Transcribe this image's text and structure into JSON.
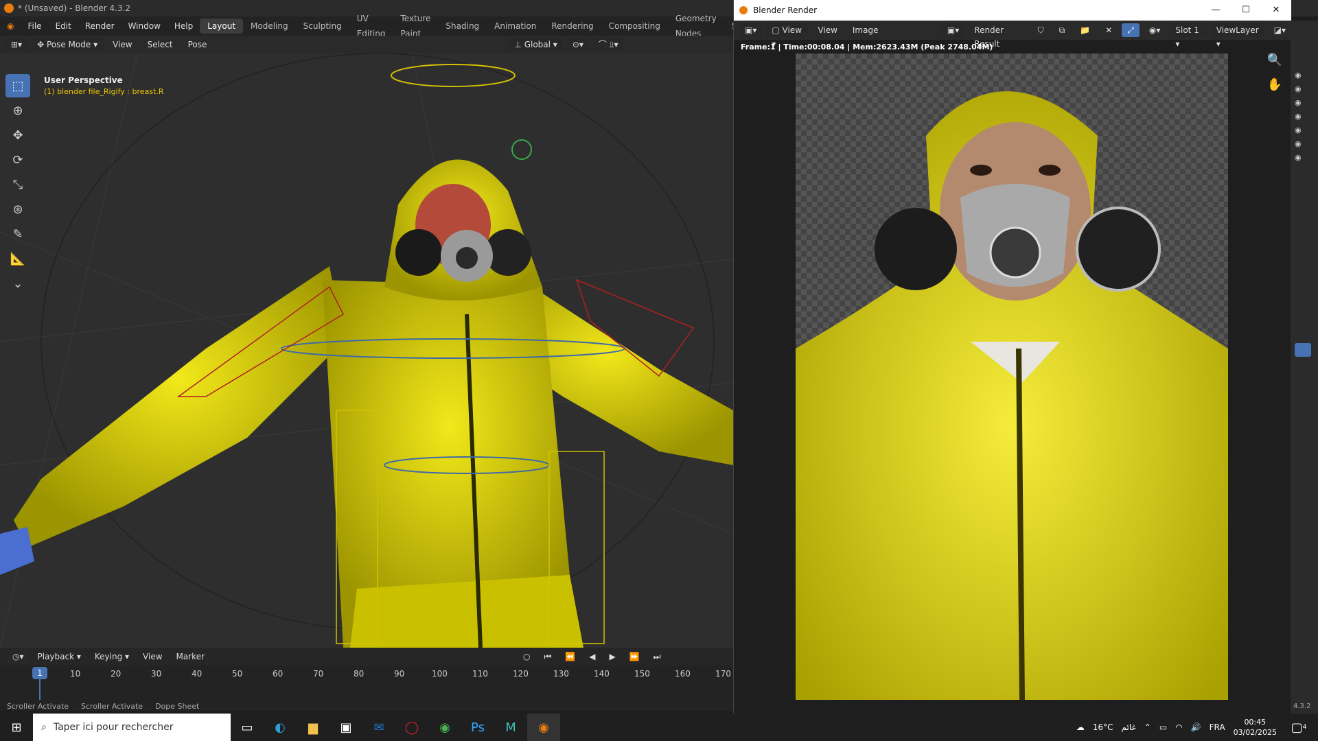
{
  "titlebar": {
    "title": "* (Unsaved) - Blender 4.3.2"
  },
  "menu": [
    "File",
    "Edit",
    "Render",
    "Window",
    "Help"
  ],
  "workspaces": [
    "Layout",
    "Modeling",
    "Sculpting",
    "UV Editing",
    "Texture Paint",
    "Shading",
    "Animation",
    "Rendering",
    "Compositing",
    "Geometry Nodes",
    "Scrip"
  ],
  "viewport_header": {
    "mode": "Pose Mode",
    "view": "View",
    "select": "Select",
    "pose": "Pose",
    "orientation": "Global"
  },
  "viewport_overlay": {
    "perspective": "User Perspective",
    "active": "(1) blender file_Rigify : breast.R"
  },
  "timeline_header": {
    "playback": "Playback",
    "keying": "Keying",
    "view": "View",
    "marker": "Marker"
  },
  "timeline": {
    "current_frame": "1",
    "ticks": [
      "10",
      "20",
      "30",
      "40",
      "50",
      "60",
      "70",
      "80",
      "90",
      "100",
      "110",
      "120",
      "130",
      "140",
      "150",
      "160",
      "170"
    ]
  },
  "statusbar": [
    "Scroller Activate",
    "Scroller Activate",
    "Dope Sheet"
  ],
  "render_window": {
    "title": "Blender Render",
    "header": {
      "view": "View",
      "view2": "View",
      "image": "Image",
      "result": "Render Result",
      "slot": "Slot 1",
      "layer": "ViewLayer"
    },
    "info": "Frame:1 | Time:00:08.04 | Mem:2623.43M (Peak 2748.04M)"
  },
  "sidebar_version": "4.3.2",
  "taskbar": {
    "search_placeholder": "Taper ici pour rechercher",
    "temperature": "16°C",
    "weather_text": "غائم",
    "language": "FRA",
    "time": "00:45",
    "date": "03/02/2025",
    "notifications": "4"
  },
  "colors": {
    "accent": "#4772b3",
    "suit": "#d9d000",
    "blender_orange": "#e87d0d"
  }
}
